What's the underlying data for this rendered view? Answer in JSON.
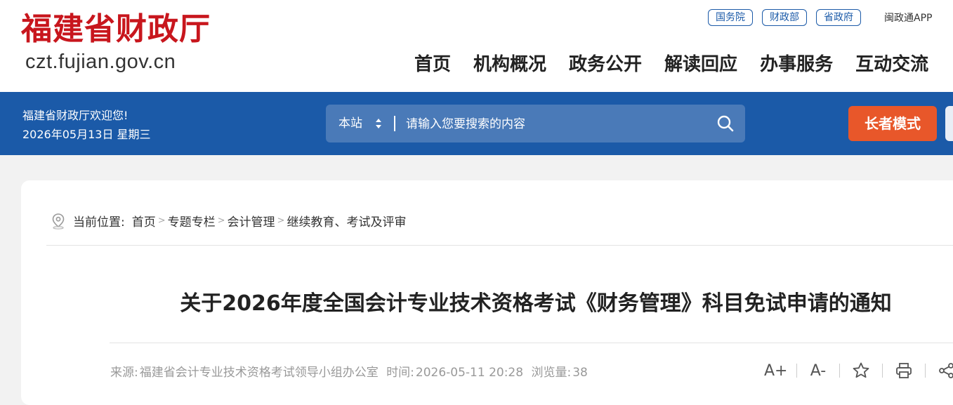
{
  "header": {
    "logo_cn": "福建省财政厅",
    "logo_url": "czt.fujian.gov.cn",
    "top_links": [
      "国务院",
      "财政部",
      "省政府"
    ],
    "app_link": "闽政通APP",
    "nav": [
      "首页",
      "机构概况",
      "政务公开",
      "解读回应",
      "办事服务",
      "互动交流"
    ]
  },
  "bar": {
    "welcome": "福建省财政厅欢迎您!",
    "date": "2026年05月13日 星期三",
    "search": {
      "scope": "本站",
      "placeholder": "请输入您要搜索的内容"
    },
    "elder_mode": "长者模式"
  },
  "article": {
    "breadcrumb_label": "当前位置:",
    "breadcrumb": [
      "首页",
      "专题专栏",
      "会计管理",
      "继续教育、考试及评审"
    ],
    "title": "关于2026年度全国会计专业技术资格考试《财务管理》科目免试申请的通知",
    "source_label": "来源:",
    "source": "福建省会计专业技术资格考试领导小组办公室",
    "time_label": "时间:",
    "time": "2026-05-11 20:28",
    "views_label": "浏览量:",
    "views": "38",
    "tools": [
      "A+",
      "A-"
    ]
  },
  "colors": {
    "brand_red": "#c8161d",
    "bar_blue": "#1b5aa8",
    "elder_orange": "#e8572a"
  },
  "icons": [
    "location-icon",
    "search-icon",
    "star-icon",
    "print-icon",
    "share-icon"
  ]
}
